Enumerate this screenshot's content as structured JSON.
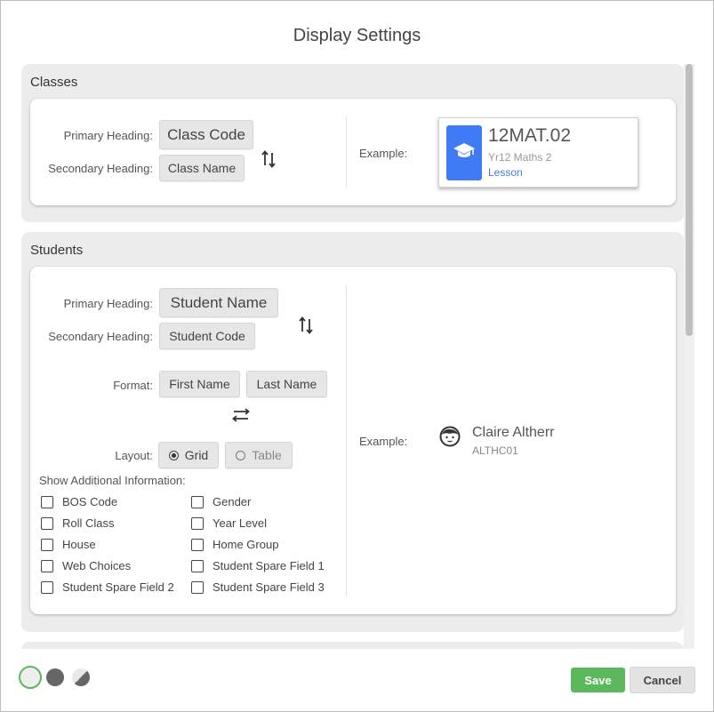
{
  "dialog": {
    "title": "Display Settings"
  },
  "classes": {
    "title": "Classes",
    "primary_label": "Primary Heading:",
    "primary_value": "Class Code",
    "secondary_label": "Secondary Heading:",
    "secondary_value": "Class Name",
    "example_label": "Example:",
    "example": {
      "title": "12MAT.02",
      "subtitle": "Yr12 Maths 2",
      "link": "Lesson",
      "icon": "graduation-cap-icon",
      "icon_color": "#3e7bf5"
    }
  },
  "students": {
    "title": "Students",
    "primary_label": "Primary Heading:",
    "primary_value": "Student Name",
    "secondary_label": "Secondary Heading:",
    "secondary_value": "Student Code",
    "format_label": "Format:",
    "format_first": "First Name",
    "format_last": "Last Name",
    "layout_label": "Layout:",
    "layout_options": [
      {
        "label": "Grid",
        "selected": true
      },
      {
        "label": "Table",
        "selected": false
      }
    ],
    "additional_label": "Show Additional Information:",
    "checkboxes_left": [
      "BOS Code",
      "Roll Class",
      "House",
      "Web Choices",
      "Student Spare Field 2"
    ],
    "checkboxes_right": [
      "Gender",
      "Year Level",
      "Home Group",
      "Student Spare Field 1",
      "Student Spare Field 3"
    ],
    "example_label": "Example:",
    "example": {
      "name": "Claire Altherr",
      "code": "ALTHC01",
      "icon": "student-face-icon"
    }
  },
  "footer": {
    "theme_options": [
      "light",
      "dark",
      "auto"
    ],
    "save_label": "Save",
    "cancel_label": "Cancel",
    "save_color": "#5cb85c"
  }
}
